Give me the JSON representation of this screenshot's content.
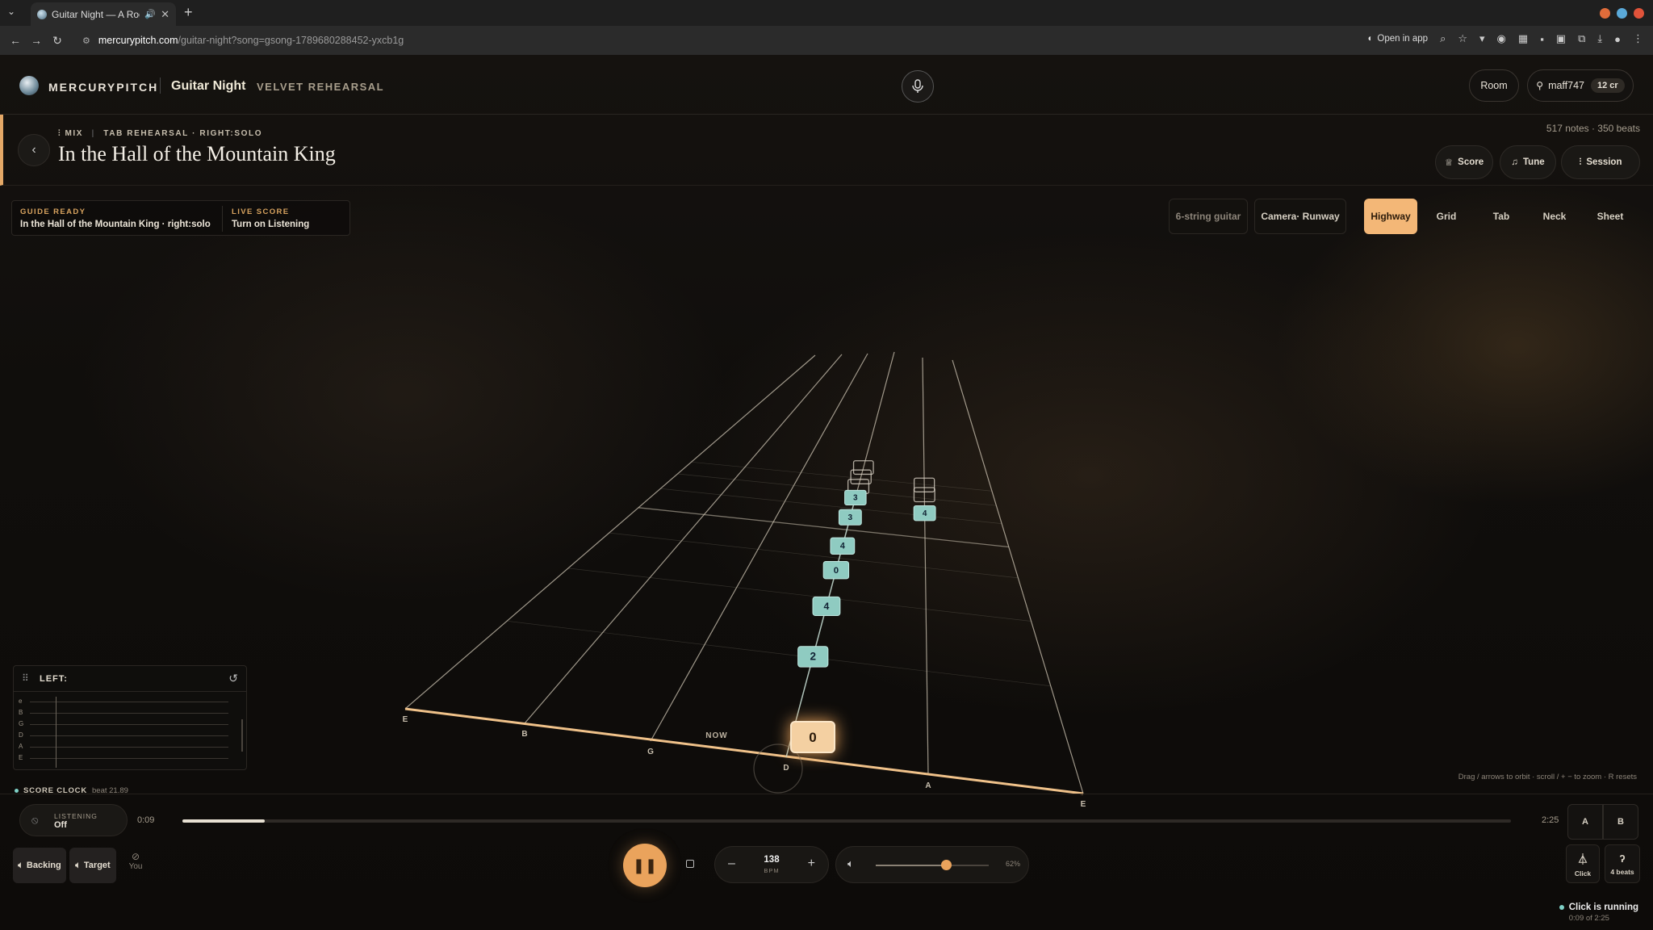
{
  "browser": {
    "tab_title": "Guitar Night — A Room Th",
    "tab_audio": "🔊",
    "url_host": "mercurypitch.com",
    "url_path": "/guitar-night?song=gsong-1789680288452-yxcb1g",
    "open_in_app": "Open in app"
  },
  "header": {
    "brand": "MERCURYPITCH",
    "room_title": "Guitar Night",
    "room_subtitle": "VELVET REHEARSAL",
    "room_button": "Room",
    "username": "maff747",
    "credits": "12 cr"
  },
  "song": {
    "crumb_mix": "MIX",
    "crumb_rest": "TAB REHEARSAL · RIGHT:SOLO",
    "title": "In the Hall of the Mountain King",
    "stats": "517 notes · 350 beats",
    "buttons": {
      "score": "Score",
      "tune": "Tune",
      "session": "Session"
    }
  },
  "guide": {
    "label1": "GUIDE READY",
    "value1": "In the Hall of the Mountain King · right:solo",
    "label2": "LIVE SCORE",
    "value2": "Turn on Listening"
  },
  "views": {
    "instrument": "6-string guitar",
    "camera": "Camera· Runway",
    "items": [
      "Highway",
      "Grid",
      "Tab",
      "Neck",
      "Sheet"
    ],
    "active": "Highway",
    "accent": "#f3b777"
  },
  "highway": {
    "strings_near": [
      "E",
      "B",
      "G",
      "D",
      "A",
      "E"
    ],
    "now_label": "NOW",
    "now_note": "0",
    "notes": [
      {
        "fret": "2",
        "beats_ahead": 1.0,
        "lane": 3
      },
      {
        "fret": "4",
        "beats_ahead": 1.8,
        "lane": 3
      },
      {
        "fret": "0",
        "beats_ahead": 2.6,
        "lane": 3
      },
      {
        "fret": "4",
        "beats_ahead": 3.3,
        "lane": 3
      },
      {
        "fret": "3",
        "beats_ahead": 4.4,
        "lane": 3
      },
      {
        "fret": "3",
        "beats_ahead": 5.4,
        "lane": 3
      },
      {
        "fret": "4",
        "beats_ahead": 5.1,
        "lane": 4
      },
      {
        "fret": "",
        "beats_ahead": 6.2,
        "lane": 4
      },
      {
        "fret": "",
        "beats_ahead": 6.9,
        "lane": 4
      },
      {
        "fret": "",
        "beats_ahead": 6.1,
        "lane": 3
      },
      {
        "fret": "",
        "beats_ahead": 6.8,
        "lane": 3
      },
      {
        "fret": "",
        "beats_ahead": 7.6,
        "lane": 3
      }
    ],
    "hint": "Drag / arrows to orbit · scroll / + − to zoom · R resets"
  },
  "left_panel": {
    "title": "LEFT:",
    "strings": [
      "e",
      "B",
      "G",
      "D",
      "A",
      "E"
    ]
  },
  "transport": {
    "score_clock": "SCORE CLOCK",
    "beat": "beat 21.89",
    "listening_label": "LISTENING",
    "listening_value": "Off",
    "elapsed": "0:09",
    "total": "2:25",
    "progress": 0.062,
    "a_label": "A",
    "b_label": "B",
    "backing": "Backing",
    "target": "Target",
    "you": "You",
    "bpm": "138",
    "bpm_unit": "BPM",
    "volume_pct": "62%",
    "volume": 0.62,
    "click": "Click",
    "count_in": "4 beats",
    "status_main": "Click is running",
    "status_sub": "0:09 of 2:25"
  }
}
